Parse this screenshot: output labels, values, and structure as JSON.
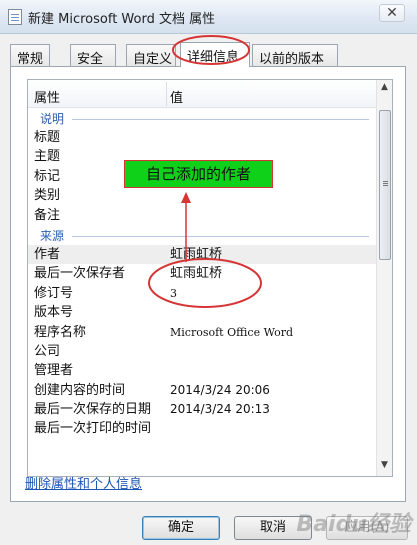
{
  "window": {
    "title": "新建 Microsoft Word 文档 属性",
    "close_label": "✕"
  },
  "tabs": [
    {
      "label": "常规",
      "active": false
    },
    {
      "label": "安全",
      "active": false
    },
    {
      "label": "自定义",
      "active": false
    },
    {
      "label": "详细信息",
      "active": true
    },
    {
      "label": "以前的版本",
      "active": false
    }
  ],
  "list": {
    "header": {
      "property": "属性",
      "value": "值"
    },
    "sections": [
      {
        "name": "说明",
        "rows": [
          {
            "property": "标题",
            "value": ""
          },
          {
            "property": "主题",
            "value": ""
          },
          {
            "property": "标记",
            "value": ""
          },
          {
            "property": "类别",
            "value": ""
          },
          {
            "property": "备注",
            "value": ""
          }
        ]
      },
      {
        "name": "来源",
        "rows": [
          {
            "property": "作者",
            "value": "虹雨虹桥"
          },
          {
            "property": "最后一次保存者",
            "value": "虹雨虹桥"
          },
          {
            "property": "修订号",
            "value": "3"
          },
          {
            "property": "版本号",
            "value": ""
          },
          {
            "property": "程序名称",
            "value": "Microsoft Office Word"
          },
          {
            "property": "公司",
            "value": ""
          },
          {
            "property": "管理者",
            "value": ""
          },
          {
            "property": "创建内容的时间",
            "value": "2014/3/24 20:06"
          },
          {
            "property": "最后一次保存的日期",
            "value": "2014/3/24 20:13"
          },
          {
            "property": "最后一次打印的时间",
            "value": ""
          }
        ]
      }
    ]
  },
  "annotation": {
    "text": "自己添加的作者",
    "fill_color": "#10d11a",
    "ink_color": "#d63535"
  },
  "remove_link": "删除属性和个人信息",
  "buttons": {
    "ok": "确定",
    "cancel": "取消",
    "apply": "应用(A)"
  },
  "watermark": "Baidu经验"
}
